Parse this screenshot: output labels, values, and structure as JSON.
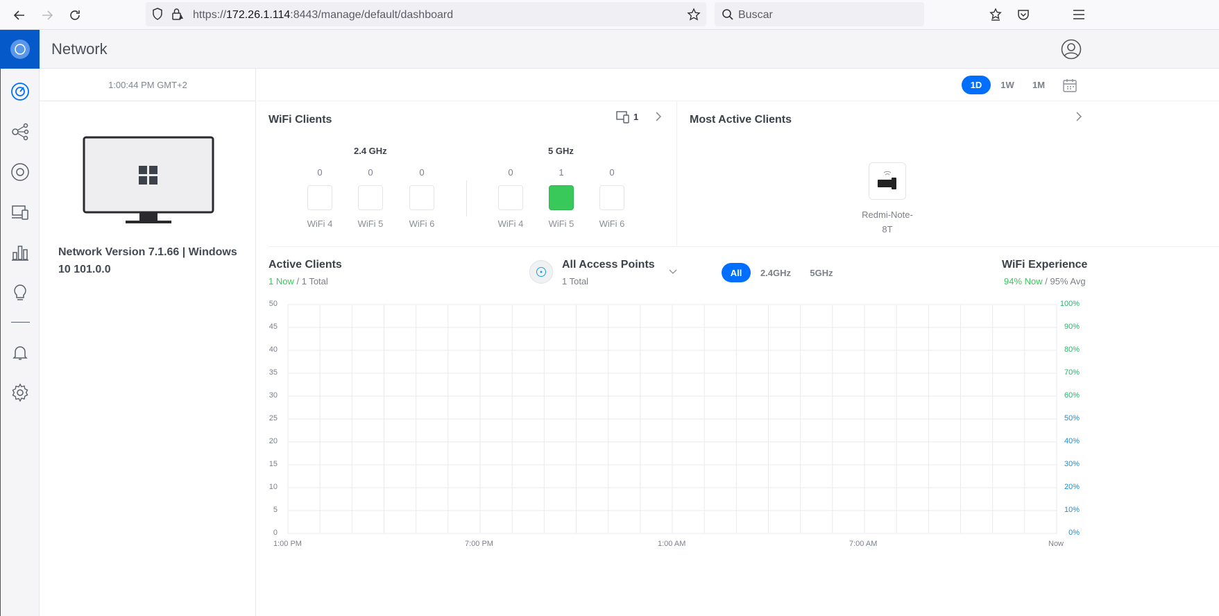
{
  "browser": {
    "url_prefix": "https://",
    "url_host": "172.26.1.114",
    "url_rest": ":8443/manage/default/dashboard",
    "search_placeholder": "Buscar"
  },
  "app": {
    "title": "Network"
  },
  "side": {
    "time": "1:00:44 PM GMT+2",
    "version": "Network Version 7.1.66 | Windows 10 101.0.0"
  },
  "range": {
    "options": [
      "1D",
      "1W",
      "1M"
    ],
    "selected": "1D"
  },
  "wifi_clients": {
    "title": "WiFi Clients",
    "device_count": "1",
    "bands": [
      {
        "label": "2.4 GHz",
        "items": [
          {
            "count": "0",
            "label": "WiFi 4"
          },
          {
            "count": "0",
            "label": "WiFi 5"
          },
          {
            "count": "0",
            "label": "WiFi 6"
          }
        ]
      },
      {
        "label": "5 GHz",
        "items": [
          {
            "count": "0",
            "label": "WiFi 4"
          },
          {
            "count": "1",
            "label": "WiFi 5"
          },
          {
            "count": "0",
            "label": "WiFi 6"
          }
        ]
      }
    ]
  },
  "most_active": {
    "title": "Most Active Clients",
    "client_line1": "Redmi-Note-",
    "client_line2": "8T"
  },
  "active_clients": {
    "title": "Active Clients",
    "now": "1 Now",
    "total": "/ 1 Total",
    "ap_title": "All Access Points",
    "ap_total": "1 Total",
    "filters": [
      "All",
      "2.4GHz",
      "5GHz"
    ],
    "selected_filter": "All",
    "experience_title": "WiFi Experience",
    "experience_now": "94% Now",
    "experience_avg": "/ 95% Avg"
  },
  "colors": {
    "accent": "#006fff",
    "green": "#38c95a",
    "right_axis_top": "#1fb86a",
    "right_axis_bottom": "#1a8fd6"
  },
  "chart_data": {
    "type": "line",
    "x_ticks": [
      "1:00 PM",
      "7:00 PM",
      "1:00 AM",
      "7:00 AM",
      "Now"
    ],
    "y_left_ticks": [
      "50",
      "45",
      "40",
      "35",
      "30",
      "25",
      "20",
      "15",
      "10",
      "5",
      "0"
    ],
    "y_right_ticks": [
      "100%",
      "90%",
      "80%",
      "70%",
      "60%",
      "50%",
      "40%",
      "30%",
      "20%",
      "10%",
      "0%"
    ],
    "ylim_left": [
      0,
      50
    ],
    "ylim_right": [
      0,
      100
    ],
    "grid": true,
    "series": []
  }
}
